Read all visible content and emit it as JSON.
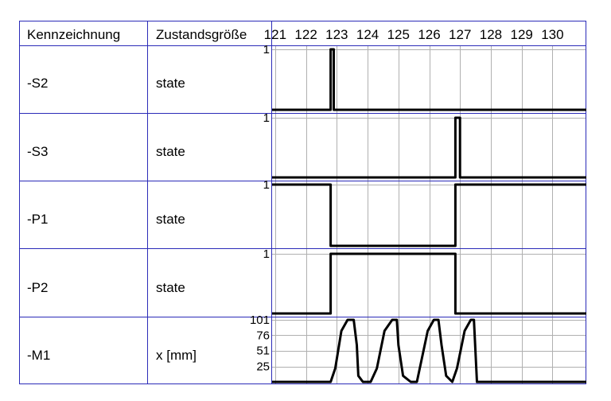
{
  "table": {
    "headers": {
      "designation": "Kennzeichnung",
      "state_variable": "Zustandsgröße"
    },
    "rows": [
      {
        "id": "-S2",
        "variable": "state"
      },
      {
        "id": "-S3",
        "variable": "state"
      },
      {
        "id": "-P1",
        "variable": "state"
      },
      {
        "id": "-P2",
        "variable": "state"
      },
      {
        "id": "-M1",
        "variable": "x [mm]"
      }
    ]
  },
  "chart_data": {
    "type": "line",
    "title": "",
    "x_ticks": [
      "121",
      "122",
      "123",
      "124",
      "125",
      "126",
      "127",
      "128",
      "129",
      "130"
    ],
    "x_range": [
      120.9,
      131.1
    ],
    "colors": {
      "grid": "#b0b0b0",
      "border": "#2b2bb8",
      "signal": "#000000"
    },
    "series": [
      {
        "name": "-S2",
        "y_ticks": [
          "1"
        ],
        "ylim": [
          0,
          1
        ],
        "x": [
          120.9,
          122.8,
          122.8,
          122.9,
          122.9,
          131.1
        ],
        "y": [
          0,
          0,
          1,
          1,
          0,
          0
        ]
      },
      {
        "name": "-S3",
        "y_ticks": [
          "1"
        ],
        "ylim": [
          0,
          1
        ],
        "x": [
          120.9,
          126.85,
          126.85,
          127.0,
          127.0,
          131.1
        ],
        "y": [
          0,
          0,
          1,
          1,
          0,
          0
        ]
      },
      {
        "name": "-P1",
        "y_ticks": [
          "1"
        ],
        "ylim": [
          0,
          1
        ],
        "x": [
          120.9,
          122.8,
          122.8,
          126.85,
          126.85,
          131.1
        ],
        "y": [
          1,
          1,
          0,
          0,
          1,
          1
        ]
      },
      {
        "name": "-P2",
        "y_ticks": [
          "1"
        ],
        "ylim": [
          0,
          1
        ],
        "x": [
          120.9,
          122.8,
          122.8,
          126.85,
          126.85,
          131.1
        ],
        "y": [
          0,
          0,
          1,
          1,
          0,
          0
        ]
      },
      {
        "name": "-M1",
        "y_ticks": [
          "101",
          "76",
          "51",
          "25"
        ],
        "ylim": [
          0,
          101
        ],
        "x": [
          120.9,
          122.8,
          122.95,
          123.15,
          123.35,
          123.55,
          123.65,
          123.7,
          123.85,
          124.1,
          124.3,
          124.55,
          124.8,
          124.95,
          125.0,
          125.15,
          125.4,
          125.6,
          125.95,
          126.15,
          126.3,
          126.4,
          126.55,
          126.75,
          126.9,
          127.15,
          127.35,
          127.45,
          127.55,
          131.1
        ],
        "y": [
          0,
          0,
          22,
          83,
          101,
          101,
          60,
          10,
          0,
          0,
          22,
          83,
          101,
          101,
          60,
          10,
          0,
          0,
          83,
          101,
          101,
          60,
          10,
          0,
          22,
          83,
          101,
          101,
          0,
          0
        ]
      }
    ]
  }
}
